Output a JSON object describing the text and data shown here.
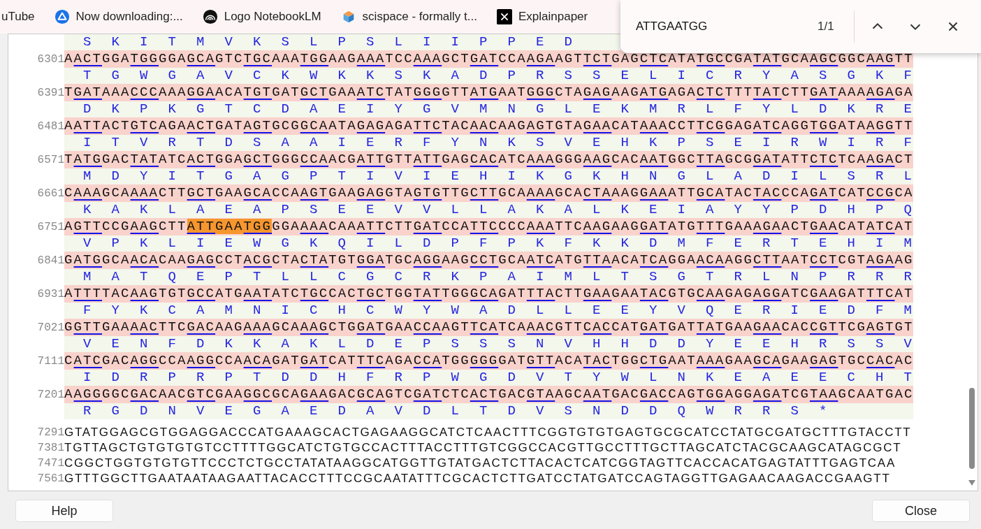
{
  "browser_tabs": [
    {
      "kind": "plain",
      "label": "uTube"
    },
    {
      "kind": "drive",
      "label": "Now downloading:..."
    },
    {
      "kind": "rings",
      "label": "Logo NotebookLM"
    },
    {
      "kind": "cube",
      "label": "scispace - formally t..."
    },
    {
      "kind": "cross",
      "label": "Explainpaper"
    }
  ],
  "find_bar": {
    "query": "ATTGAATGG",
    "count": "1/1"
  },
  "sequence_view": {
    "partial_translation": "S K I T M V K S L P S L I I P P E D",
    "rows": [
      {
        "kind": "coding",
        "number": "6301",
        "bases": [
          {
            "text": "AACTGGATGGGGAGCAGTCTGCAAATGGAAGAAATCCAAAGCTGATCCAAGAAGTTCTGAGCTCATATGCCGATATGCAAGCGGCAAGTT",
            "highlighted": false
          }
        ],
        "translation": "T G W G A V C K W K K S K A D P R S S E L I C R Y A S G K F"
      },
      {
        "kind": "coding",
        "number": "6391",
        "bases": [
          {
            "text": "TGATAAACCCAAAGGAACATGTGATGCTGAAATCTATGGGGTTATGAATGGGCTAGAGAAGATGAGACTCTTTTATCTTGATAAAAGAGA",
            "highlighted": false
          }
        ],
        "translation": "D K P K G T C D A E I Y G V M N G L E K M R L F Y L D K R E"
      },
      {
        "kind": "coding",
        "number": "6481",
        "bases": [
          {
            "text": "AATTACTGTCAGAACTGATAGTGCGGCAATAGAGAGATTCTACAACAAGAGTGTAGAACATAAACCTTCGGAGATCAGGTGGATAAGGTT",
            "highlighted": false
          }
        ],
        "translation": "I T V R T D S A A I E R F Y N K S V E H K P S E I R W I R F"
      },
      {
        "kind": "coding",
        "number": "6571",
        "bases": [
          {
            "text": "TATGGACTATATCACTGGAGCTGGGCCAACGATTGTTATTGAGCACATCAAAGGGAAGCACAATGGCTTAGCGGATATTCTCTCAAGACT",
            "highlighted": false
          }
        ],
        "translation": "M D Y I T G A G P T I V I E H I K G K H N G L A D I L S R L"
      },
      {
        "kind": "coding",
        "number": "6661",
        "bases": [
          {
            "text": "CAAAGCAAAACTTGCTGAAGCACCAAGTGAAGAGGTAGTGTTGCTTGCAAAAGCACTAAAGGAAATTGCATACTACCCAGATCATCCGCA",
            "highlighted": false
          }
        ],
        "translation": "K A K L A E A P S E E V V L L A K A L K E I A Y Y P D H P Q"
      },
      {
        "kind": "coding",
        "number": "6751",
        "bases": [
          {
            "text": "AGTTCCGAAGCTT",
            "highlighted": false
          },
          {
            "text": "ATTGAATGG",
            "highlighted": true
          },
          {
            "text": "GGAAAACAAATTCTTGATCCATTCCCCAAATTCAAGAAGGATATGTTTGAAAGAACTGAACATATCAT",
            "highlighted": false
          }
        ],
        "translation": "V P K L I E W G K Q I L D P F P K F K K D M F E R T E H I M"
      },
      {
        "kind": "coding",
        "number": "6841",
        "bases": [
          {
            "text": "GATGGCAACACAAGAGCCTACGCTACTATGTGGATGCAGGAAGCCTGCAATCATGTTAACATCAGGAACAAGGCTTAATCCTCGTAGAAG",
            "highlighted": false
          }
        ],
        "translation": "M A T Q E P T L L C G C R K P A I M L T S G T R L N P R R R"
      },
      {
        "kind": "coding",
        "number": "6931",
        "bases": [
          {
            "text": "ATTTTACAAGTGTGCCATGAATATCTGCCACTGCTGGTATTGGGCAGATTTACTTGAAGAATACGTGCAAGAGAGGATCGAAGATTTCAT",
            "highlighted": false
          }
        ],
        "translation": "F Y K C A M N I C H C W Y W A D L L E E Y V Q E R I E D F M"
      },
      {
        "kind": "coding",
        "number": "7021",
        "bases": [
          {
            "text": "GGTTGAAAACTTCGACAAGAAAGCAAAGCTGGATGAACCAAGTTCATCAAACGTTCACCATGATGATTATGAAGAACACCGTTCGAGTGT",
            "highlighted": false
          }
        ],
        "translation": "V E N F D K K A K L D E P S S S N V H H D D Y E E H R S S V"
      },
      {
        "kind": "coding",
        "number": "7111",
        "bases": [
          {
            "text": "CATCGACAGGCCAAGGCCAACAGATGATCATTTCAGACCATGGGGGGATGTTACATACTGGCTGAATAAAGAAGCAGAAGAGTGCCACAC",
            "highlighted": false
          }
        ],
        "translation": "I D R P R P T D D H F R P W G D V T Y W L N K E A E E C H T"
      },
      {
        "kind": "coding",
        "number": "7201",
        "bases": [
          {
            "text": "AAGGGGCGACAACGTCGAAGGCGCAGAAGACGCAGTCGATCTCACTGACGTAAGCAATGACGACCAGTGGAGGAGATCGTAAGCAATGAC",
            "highlighted": false
          }
        ],
        "translation": "R G D N V E G A E D A V D L T D V S N D D Q W R R S *"
      },
      {
        "kind": "plain",
        "number": "7291",
        "bases": [
          {
            "text": "GTATGGAGCGTGGAGGACCCATGAAAGCACTGAGAAGGCATCTCAACTTTCGGTGTGTGAGTGCGCATCCTATGCGATGCTTTGTACCTT",
            "highlighted": false
          }
        ]
      },
      {
        "kind": "plain",
        "number": "7381",
        "bases": [
          {
            "text": "TGTTAGCTGTGTGTGTCCTTTTGGCATCTGTGCCACTTTACCTTTGTCGGCCACGTTGCCTTTGCTTAGCATCTACGCAAGCATAGCGCT",
            "highlighted": false
          }
        ]
      },
      {
        "kind": "plain",
        "number": "7471",
        "bases": [
          {
            "text": "CGGCTGGTGTGTGTTCCCTCTGCCTATATAAGGCATGGTTGTATGACTCTTACACTCATCGGTAGTTCACCACATGAGTATTTGAGTCAA",
            "highlighted": false
          }
        ]
      },
      {
        "kind": "plain",
        "number": "7561",
        "bases": [
          {
            "text": "GTTTGGCTTGAATAATAAGAATTACACCTTTCCGCAATATTTCGCACTCTTGATCCTATGATCCAGTAGGTTGAGAACAAGACCGAAGTT",
            "highlighted": false
          }
        ]
      }
    ]
  },
  "buttons": [
    {
      "label": "Help"
    },
    {
      "label": "Close"
    }
  ]
}
